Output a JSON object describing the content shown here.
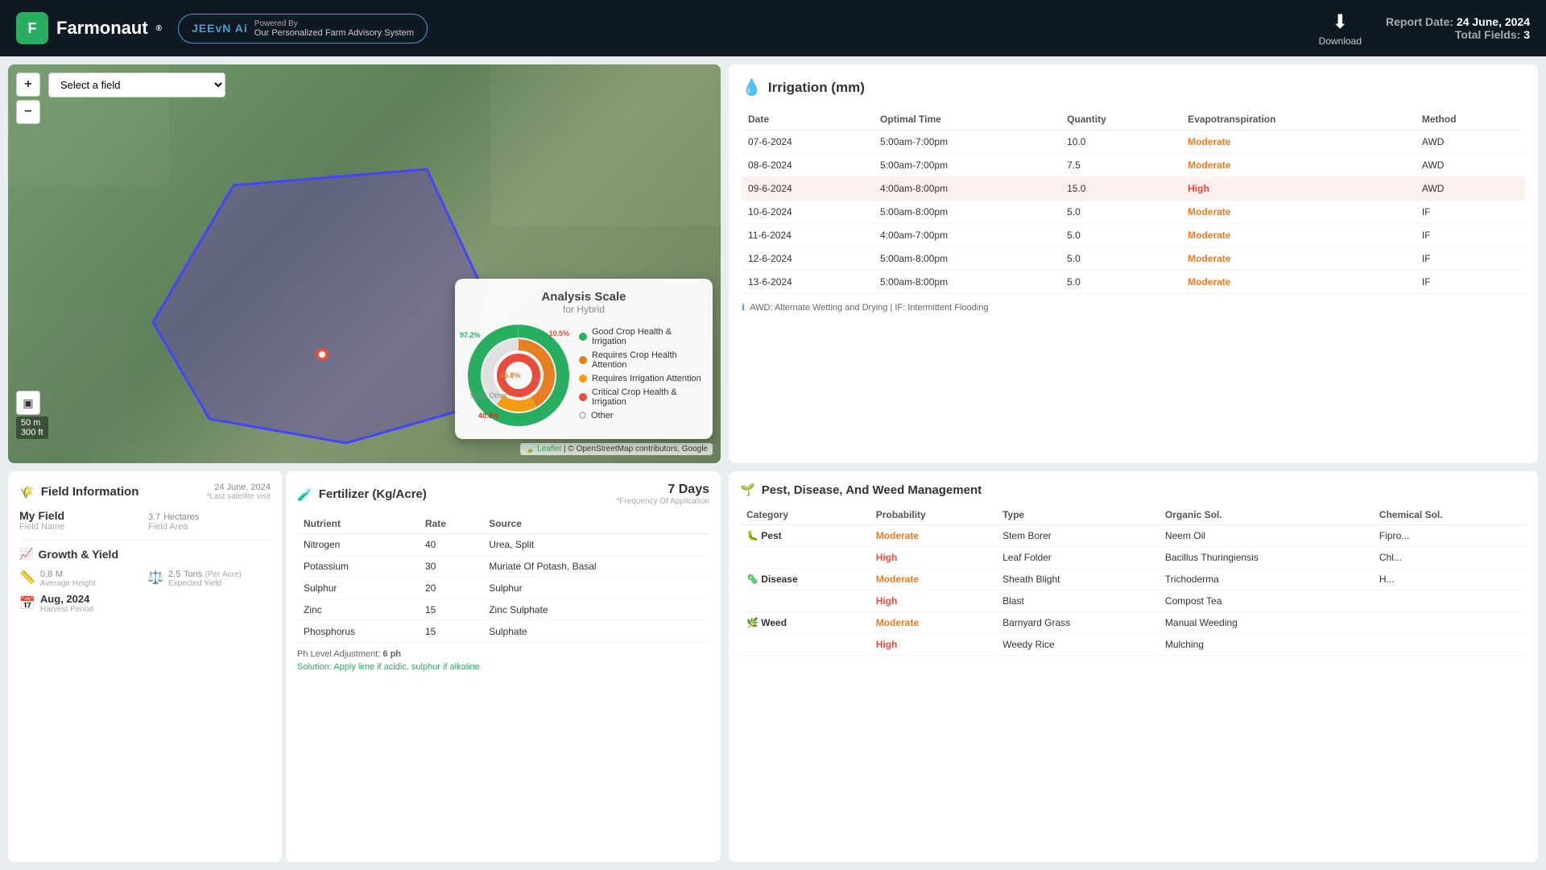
{
  "header": {
    "logo_text": "Farmonaut",
    "reg_symbol": "®",
    "jeevn_title": "JEEvN Ai",
    "powered_by": "Powered By",
    "advisory_text": "Our Personalized Farm Advisory System",
    "download_label": "Download",
    "report_date_label": "Report Date:",
    "report_date": "24 June, 2024",
    "total_fields_label": "Total Fields:",
    "total_fields": "3"
  },
  "map": {
    "select_placeholder": "Select a field",
    "scale_m": "50 m",
    "scale_ft": "300 ft",
    "attribution": "Leaflet | © OpenStreetMap contributors, Google"
  },
  "analysis_scale": {
    "title": "Analysis Scale",
    "subtitle": "for Hybrid",
    "labels": {
      "p1": "97.2%",
      "p2": "10.5%",
      "p3": "45.8%",
      "p4": "5%",
      "p4_label": "Other",
      "p5": "40.8%"
    },
    "legend": [
      {
        "color": "#27ae60",
        "label": "Good Crop Health & Irrigation"
      },
      {
        "color": "#e67e22",
        "label": "Requires Crop Health Attention"
      },
      {
        "color": "#f39c12",
        "label": "Requires Irrigation Attention"
      },
      {
        "color": "#e74c3c",
        "label": "Critical Crop Health & Irrigation"
      },
      {
        "color": "#bbb",
        "label": "Other",
        "ring": true
      }
    ]
  },
  "irrigation": {
    "title": "Irrigation (mm)",
    "columns": [
      "Date",
      "Optimal Time",
      "Quantity",
      "Evapotranspiration",
      "Method"
    ],
    "rows": [
      {
        "date": "07-6-2024",
        "time": "5:00am-7:00pm",
        "qty": "10.0",
        "evap": "Moderate",
        "method": "AWD",
        "highlight": false
      },
      {
        "date": "08-6-2024",
        "time": "5:00am-7:00pm",
        "qty": "7.5",
        "evap": "Moderate",
        "method": "AWD",
        "highlight": false
      },
      {
        "date": "09-6-2024",
        "time": "4:00am-8:00pm",
        "qty": "15.0",
        "evap": "High",
        "method": "AWD",
        "highlight": true
      },
      {
        "date": "10-6-2024",
        "time": "5:00am-8:00pm",
        "qty": "5.0",
        "evap": "Moderate",
        "method": "IF",
        "highlight": false
      },
      {
        "date": "11-6-2024",
        "time": "4:00am-7:00pm",
        "qty": "5.0",
        "evap": "Moderate",
        "method": "IF",
        "highlight": false
      },
      {
        "date": "12-6-2024",
        "time": "5:00am-8:00pm",
        "qty": "5.0",
        "evap": "Moderate",
        "method": "IF",
        "highlight": false
      },
      {
        "date": "13-6-2024",
        "time": "5:00am-8:00pm",
        "qty": "5.0",
        "evap": "Moderate",
        "method": "IF",
        "highlight": false
      }
    ],
    "note": "AWD: Alternate Wetting and Drying | IF: Intermittent Flooding"
  },
  "field_info": {
    "title": "Field Information",
    "date": "24 June, 2024",
    "last_visit": "*Last satellite visit",
    "name_label": "Field Name",
    "name_val": "My Field",
    "area_label": "Field Area",
    "area_val": "3.7",
    "area_unit": "Hectares"
  },
  "growth": {
    "title": "Growth & Yield",
    "height_val": "0.8",
    "height_unit": "M",
    "height_label": "Average Height",
    "yield_val": "2.5",
    "yield_unit": "Tons",
    "yield_per": "(Per Acre)",
    "yield_label": "Expected Yield",
    "harvest_val": "Aug, 2024",
    "harvest_label": "Harvest Period"
  },
  "fertilizer": {
    "title": "Fertilizer (Kg/Acre)",
    "days": "7 Days",
    "freq_label": "*Frequency Of Application",
    "columns": [
      "Nutrient",
      "Rate",
      "Source"
    ],
    "rows": [
      {
        "nutrient": "Nitrogen",
        "rate": "40",
        "source": "Urea, Split"
      },
      {
        "nutrient": "Potassium",
        "rate": "30",
        "source": "Muriate Of Potash, Basal"
      },
      {
        "nutrient": "Sulphur",
        "rate": "20",
        "source": "Sulphur"
      },
      {
        "nutrient": "Zinc",
        "rate": "15",
        "source": "Zinc Sulphate"
      },
      {
        "nutrient": "Phosphorus",
        "rate": "15",
        "source": "Sulphate"
      }
    ],
    "ph_label": "Ph Level Adjustment:",
    "ph_val": "6 ph",
    "solution_label": "Solution:",
    "solution_val": "Apply lime if acidic, sulphur if alkaline"
  },
  "pest": {
    "title": "Pest, Disease, And Weed Management",
    "columns": [
      "Category",
      "Probability",
      "Type",
      "Organic Sol.",
      "Chemical Sol."
    ],
    "rows": [
      {
        "category": "Pest",
        "cat_icon": "🐛",
        "prob": "Moderate",
        "type": "Stem Borer",
        "organic": "Neem Oil",
        "chemical": "Fipro...",
        "prob_level": "moderate"
      },
      {
        "category": "",
        "cat_icon": "",
        "prob": "High",
        "type": "Leaf Folder",
        "organic": "Bacillus Thuringiensis",
        "chemical": "Chl...",
        "prob_level": "high"
      },
      {
        "category": "Disease",
        "cat_icon": "🦠",
        "prob": "Moderate",
        "type": "Sheath Blight",
        "organic": "Trichoderma",
        "chemical": "H...",
        "prob_level": "moderate"
      },
      {
        "category": "",
        "cat_icon": "",
        "prob": "High",
        "type": "Blast",
        "organic": "Compost Tea",
        "chemical": "",
        "prob_level": "high"
      },
      {
        "category": "Weed",
        "cat_icon": "🌿",
        "prob": "Moderate",
        "type": "Barnyard Grass",
        "organic": "Manual Weeding",
        "chemical": "",
        "prob_level": "moderate"
      },
      {
        "category": "",
        "cat_icon": "",
        "prob": "High",
        "type": "Weedy Rice",
        "organic": "Mulching",
        "chemical": "",
        "prob_level": "high"
      }
    ]
  }
}
